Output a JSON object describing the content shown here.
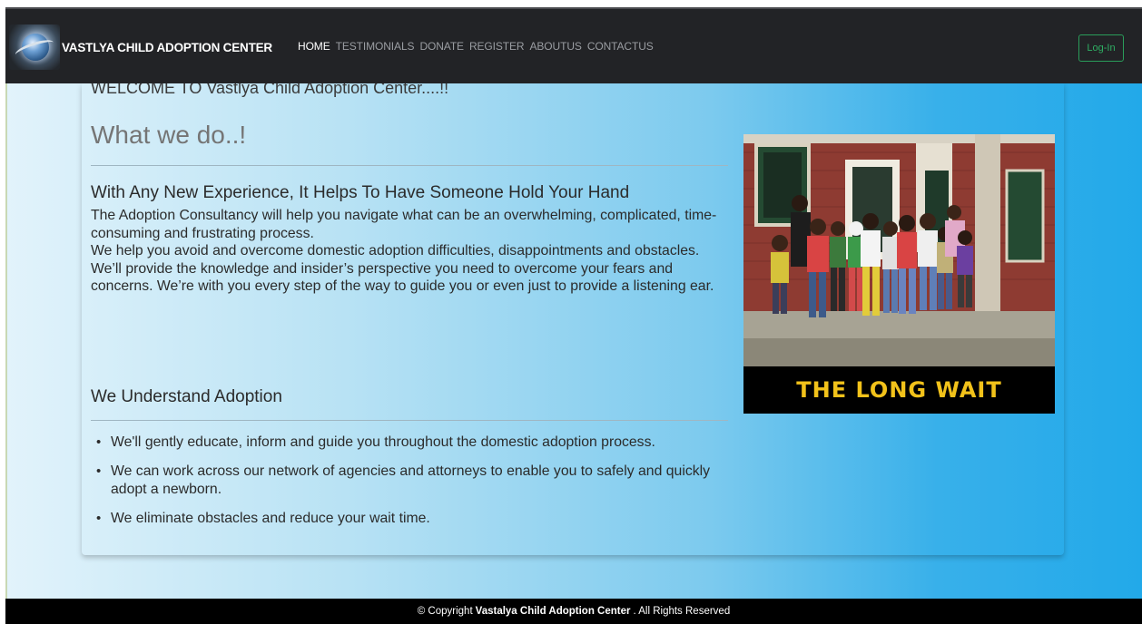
{
  "header": {
    "brand_name": "VASTLYA CHILD ADOPTION CENTER",
    "nav": [
      "HOME",
      "TESTIMONIALS",
      "DONATE",
      "REGISTER",
      "ABOUTUS",
      "CONTACTUS"
    ],
    "active_nav": "HOME",
    "login_label": "Log-In"
  },
  "main": {
    "welcome": "WELCOME TO Vastlya Child Adoption Center....!!",
    "section_title": "What we do..!",
    "subheading": "With Any New Experience, It Helps To Have Someone Hold Your Hand",
    "paragraphs": [
      "The Adoption Consultancy will help you navigate what can be an overwhelming, complicated, time-consuming and frustrating process.",
      "We help you avoid and overcome domestic adoption difficulties, disappointments and obstacles.",
      "We’ll provide the knowledge and insider’s perspective you need to overcome your fears and concerns. We’re with you every step of the way to guide you or even just to provide a listening ear."
    ],
    "subheading2": "We Understand Adoption",
    "bullets": [
      "We'll gently educate, inform and guide you throughout the domestic adoption process.",
      "We can work across our network of agencies and attorneys to enable you to safely and quickly adopt a newborn.",
      "We eliminate obstacles and reduce your wait time."
    ],
    "image_caption": "THE LONG WAIT"
  },
  "footer": {
    "prefix": "© Copyright",
    "org": "Vastalya Child Adoption Center",
    "suffix": ". All Rights Reserved"
  },
  "colors": {
    "navbar": "#222326",
    "footer": "#000000",
    "login_border": "#2a9d5a",
    "caption_text": "#f2c21a",
    "gradient_start": "#e2f3fb",
    "gradient_end": "#22a9e9"
  }
}
